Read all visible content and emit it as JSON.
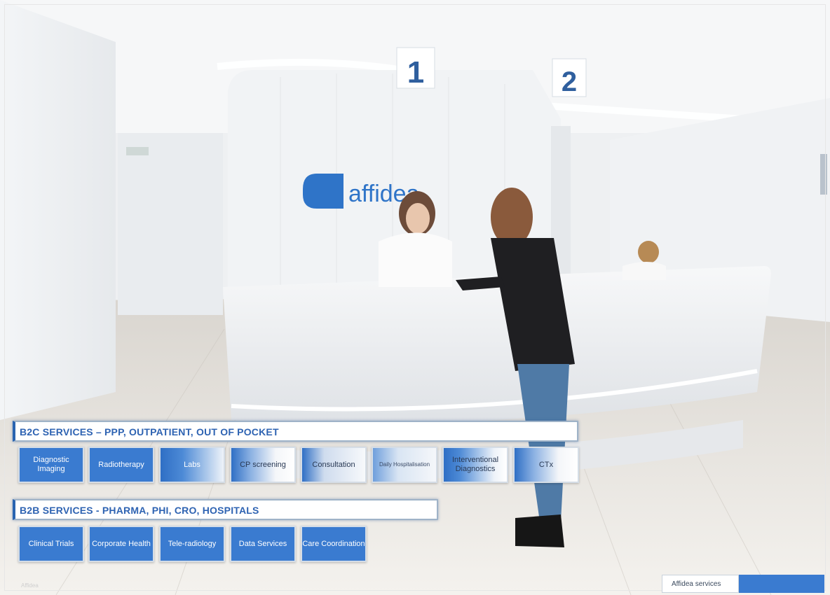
{
  "b2c": {
    "title": "B2C SERVICES – PPP, OUTPATIENT, OUT OF POCKET",
    "tiles": [
      "Diagnostic Imaging",
      "Radiotherapy",
      "Labs",
      "CP screening",
      "Consultation",
      "Daily Hospitalisation",
      "Interventional Diagnostics",
      "CTx"
    ]
  },
  "b2b": {
    "title": "B2B SERVICES - PHARMA, PHI, CRO, HOSPITALS",
    "tiles": [
      "Clinical Trials",
      "Corporate Health",
      "Tele-radiology",
      "Data Services",
      "Care Coordination"
    ]
  },
  "photo": {
    "brand": "affidea",
    "counter_1": "1",
    "counter_2": "2"
  },
  "footer": {
    "label": "Affidea services",
    "watermark": "Affidea"
  },
  "colors": {
    "accent": "#2e63b2",
    "tile_blue": "#3a7bd0"
  }
}
